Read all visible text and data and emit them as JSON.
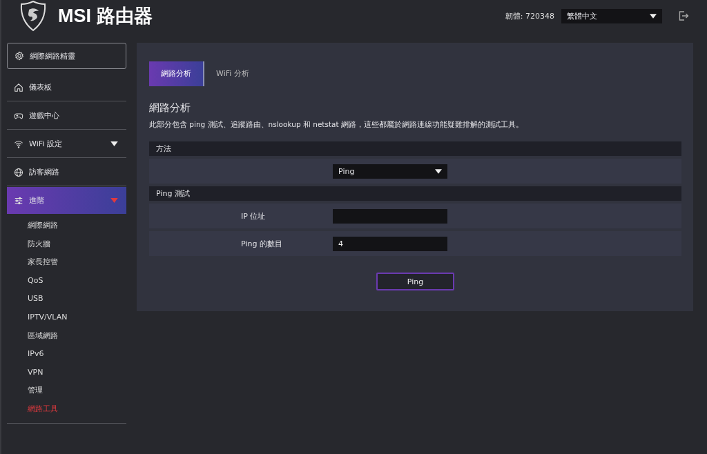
{
  "header": {
    "title": "MSI 路由器",
    "firmware": "韌體: 720348",
    "language": "繁體中文"
  },
  "sidebar": {
    "items": [
      {
        "kind": "wizard",
        "label": "網際網路精靈",
        "selected": false
      },
      {
        "kind": "item",
        "label": "儀表板",
        "selected": false
      },
      {
        "kind": "item",
        "label": "遊戲中心",
        "selected": false
      },
      {
        "kind": "item",
        "label": "WiFi 設定",
        "selected": false,
        "expanded": false
      },
      {
        "kind": "item",
        "label": "訪客網路",
        "selected": false
      },
      {
        "kind": "item",
        "label": "進階",
        "selected": true,
        "expanded": true,
        "children": [
          {
            "label": "網際網路",
            "selected": false
          },
          {
            "label": "防火牆",
            "selected": false
          },
          {
            "label": "家長控管",
            "selected": false
          },
          {
            "label": "QoS",
            "selected": false
          },
          {
            "label": "USB",
            "selected": false
          },
          {
            "label": "IPTV/VLAN",
            "selected": false
          },
          {
            "label": "區域網路",
            "selected": false
          },
          {
            "label": "IPv6",
            "selected": false
          },
          {
            "label": "VPN",
            "selected": false
          },
          {
            "label": "管理",
            "selected": false
          },
          {
            "label": "網路工具",
            "selected": true
          }
        ]
      }
    ]
  },
  "tabs": [
    {
      "label": "網路分析",
      "selected": true
    },
    {
      "label": "WiFi 分析",
      "selected": false
    }
  ],
  "content": {
    "heading": "網路分析",
    "description": "此部分包含 ping 測試、追蹤路由、nslookup 和 netstat 網路，這些都屬於網路連線功能疑難排解的測試工具。",
    "sections": [
      {
        "title": "方法",
        "rows": [
          {
            "kind": "select",
            "value": "Ping"
          }
        ]
      },
      {
        "title": "Ping 測試",
        "rows": [
          {
            "kind": "input",
            "label": "IP 位址"
          },
          {
            "kind": "input",
            "label": "Ping 的數目",
            "value": "4"
          }
        ]
      }
    ],
    "button": "Ping"
  }
}
